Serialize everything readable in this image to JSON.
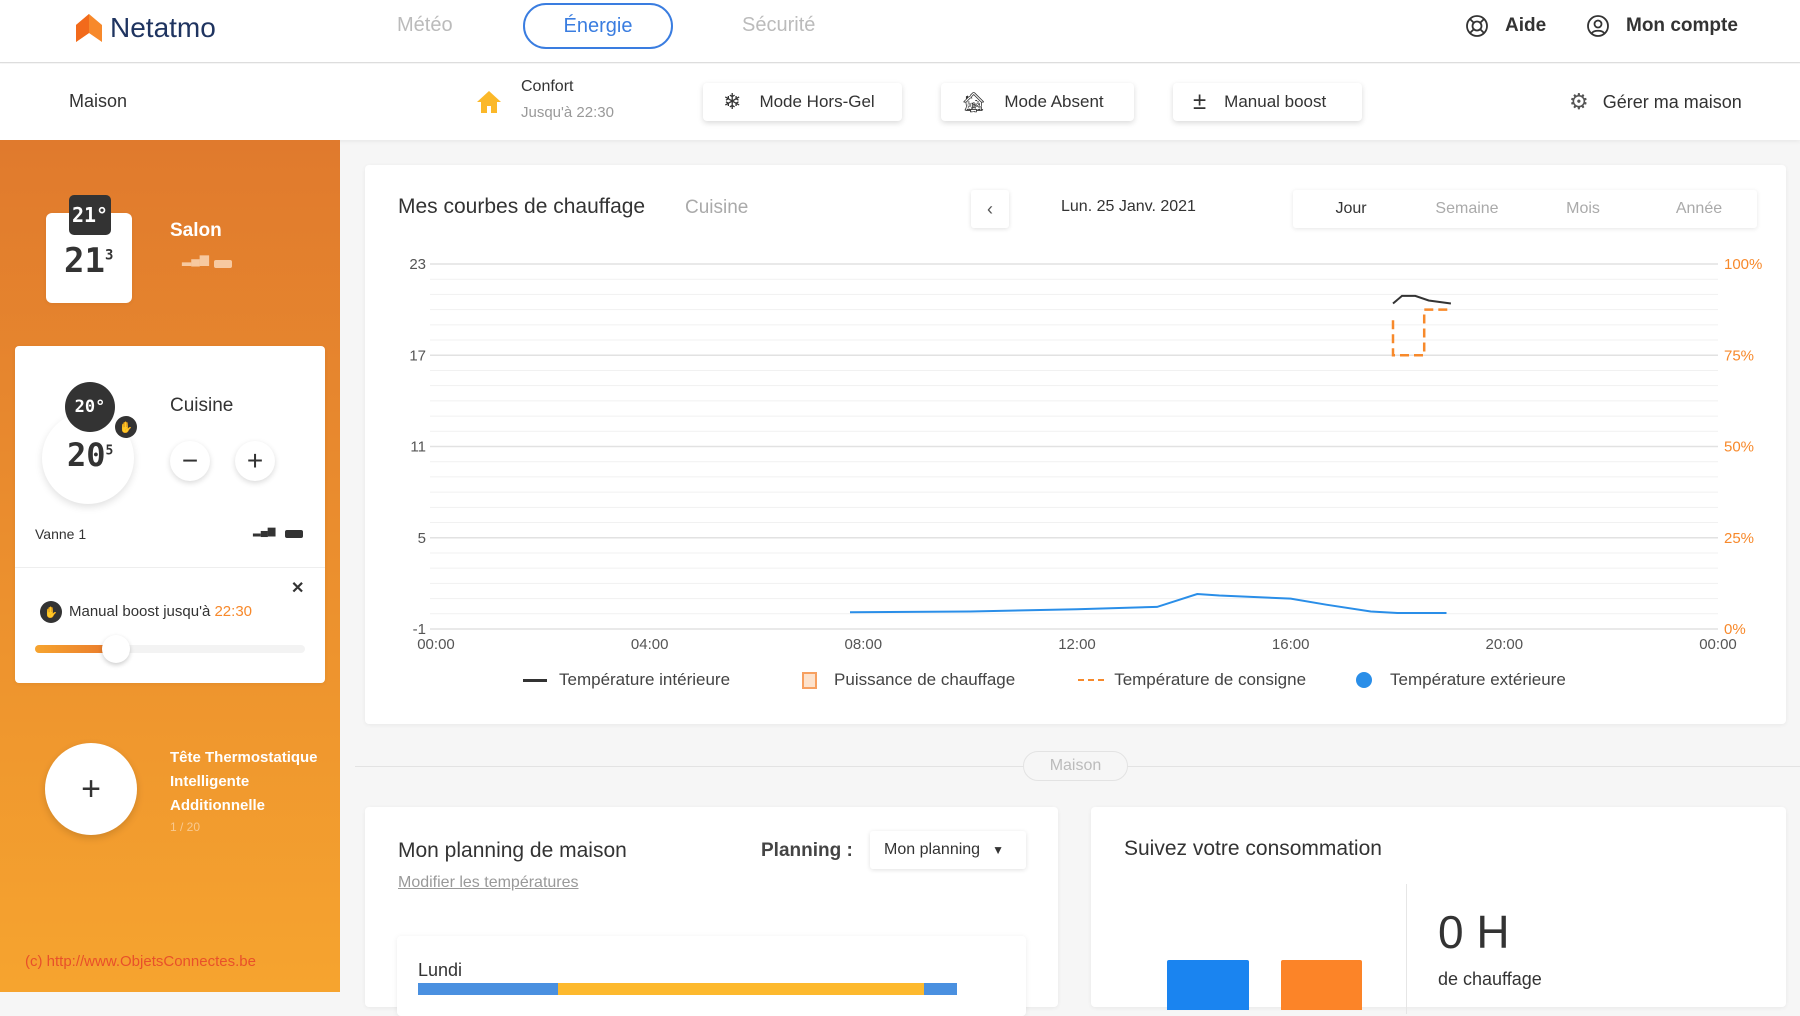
{
  "brand": {
    "name": "Netatmo",
    "accent": "#f7892b"
  },
  "nav": {
    "tabs": [
      "Météo",
      "Énergie",
      "Sécurité"
    ],
    "active": "Énergie",
    "help": "Aide",
    "account": "Mon compte"
  },
  "subnav": {
    "home": "Maison",
    "mode": "Confort",
    "mode_until": "Jusqu'à 22:30",
    "buttons": [
      "Mode Hors-Gel",
      "Mode Absent",
      "Manual boost"
    ],
    "manage": "Gérer ma maison"
  },
  "sidebar": {
    "salon": {
      "name": "Salon",
      "setpoint": "21°",
      "current_int": "21",
      "current_dec": "3"
    },
    "cuisine": {
      "name": "Cuisine",
      "setpoint": "20°",
      "current_int": "20",
      "current_dec": "5",
      "valve": "Vanne 1",
      "boost_label": "Manual boost jusqu'à",
      "boost_time": "22:30",
      "boost_slider_fraction": 0.3
    },
    "add": {
      "label": "Tête Thermostatique Intelligente Additionnelle",
      "count": "1 / 20"
    },
    "watermark": "(c) http://www.ObjetsConnectes.be"
  },
  "chart_card": {
    "title": "Mes courbes de chauffage",
    "room": "Cuisine",
    "date": "Lun. 25 Janv. 2021",
    "periods": [
      "Jour",
      "Semaine",
      "Mois",
      "Année"
    ],
    "active_period": "Jour"
  },
  "chart_data": {
    "type": "line",
    "x_ticks": [
      "00:00",
      "04:00",
      "08:00",
      "12:00",
      "16:00",
      "20:00",
      "00:00"
    ],
    "y_left_ticks": [
      23,
      17,
      11,
      5,
      -1
    ],
    "ylim": [
      -1,
      23
    ],
    "y_right_ticks": [
      "100%",
      "75%",
      "50%",
      "25%",
      "0%"
    ],
    "grid": true,
    "legend_placement": "bottom",
    "series": [
      {
        "name": "Température intérieure",
        "color": "#333333",
        "style": "solid",
        "points": [
          [
            "17:55",
            20.4
          ],
          [
            "18:05",
            20.9
          ],
          [
            "18:20",
            20.9
          ],
          [
            "18:35",
            20.6
          ],
          [
            "19:00",
            20.4
          ]
        ]
      },
      {
        "name": "Puissance de chauffage",
        "color": "#f7892b",
        "style": "box",
        "points": []
      },
      {
        "name": "Température de consigne",
        "color": "#f7892b",
        "style": "dashed",
        "points": [
          [
            "17:55",
            19.3
          ],
          [
            "17:55",
            17
          ],
          [
            "18:30",
            17
          ],
          [
            "18:30",
            20
          ],
          [
            "19:00",
            20
          ]
        ]
      },
      {
        "name": "Température extérieure",
        "color": "#2a8ee8",
        "style": "solid",
        "points": [
          [
            "07:45",
            0.1
          ],
          [
            "10:00",
            0.15
          ],
          [
            "12:00",
            0.3
          ],
          [
            "13:30",
            0.45
          ],
          [
            "14:15",
            1.3
          ],
          [
            "14:40",
            1.2
          ],
          [
            "16:00",
            1.0
          ],
          [
            "16:40",
            0.6
          ],
          [
            "17:30",
            0.15
          ],
          [
            "18:00",
            0.05
          ],
          [
            "18:55",
            0.05
          ]
        ]
      }
    ]
  },
  "divider": "Maison",
  "planning": {
    "title": "Mon planning de maison",
    "label": "Planning :",
    "selected": "Mon planning",
    "edit_link": "Modifier les températures",
    "day": "Lundi"
  },
  "consumption": {
    "title": "Suivez votre consommation",
    "value": "0 H",
    "unit_label": "de chauffage"
  }
}
